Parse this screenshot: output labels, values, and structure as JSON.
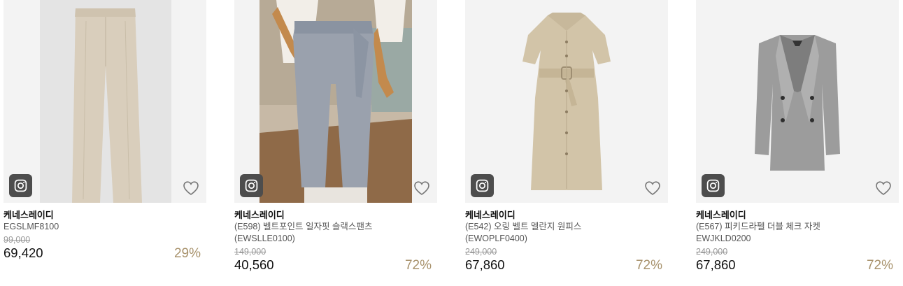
{
  "products": [
    {
      "brand": "케네스레이디",
      "name": "EGSLMF8100",
      "original_price": "99,000",
      "price": "69,420",
      "discount": "29%"
    },
    {
      "brand": "케네스레이디",
      "name": "(E598) 벨트포인트 일자핏 슬랙스팬츠 (EWSLLE0100)",
      "original_price": "149,000",
      "price": "40,560",
      "discount": "72%"
    },
    {
      "brand": "케네스레이디",
      "name": "(E542) 오링 벨트 멜란지 원피스 (EWOPLF0400)",
      "original_price": "249,000",
      "price": "67,860",
      "discount": "72%"
    },
    {
      "brand": "케네스레이디",
      "name": "(E567) 피키드라펠 더블 체크 자켓 EWJKLD0200",
      "original_price": "249,000",
      "price": "67,860",
      "discount": "72%"
    }
  ],
  "icons": {
    "social": "instagram-icon",
    "wishlist": "heart-icon"
  },
  "colors": {
    "discount": "#a8926c",
    "icon_bg": "#4d4d4d"
  }
}
